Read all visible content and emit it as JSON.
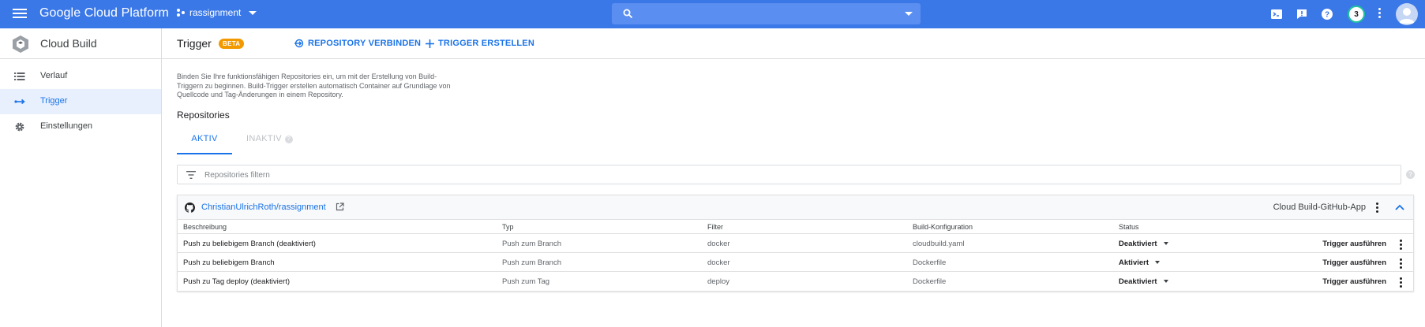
{
  "topbar": {
    "brand": "Google Cloud Platform",
    "project": "rassignment",
    "search_placeholder": "",
    "notification_count": "3",
    "accent_color": "#3b78e7"
  },
  "sidebar": {
    "title": "Cloud Build",
    "items": [
      {
        "label": "Verlauf",
        "icon": "list-icon",
        "active": false
      },
      {
        "label": "Trigger",
        "icon": "trigger-arrows-icon",
        "active": true
      },
      {
        "label": "Einstellungen",
        "icon": "gear-icon",
        "active": false
      }
    ]
  },
  "header": {
    "title": "Trigger",
    "badge": "BETA",
    "connect_repo": "REPOSITORY VERBINDEN",
    "create_trigger": "TRIGGER ERSTELLEN"
  },
  "main": {
    "intro": "Binden Sie Ihre funktionsfähigen Repositories ein, um mit der Erstellung von Build-Triggern zu beginnen. Build-Trigger erstellen automatisch Container auf Grundlage von Quellcode und Tag-Änderungen in einem Repository.",
    "section_title": "Repositories",
    "tabs": [
      {
        "label": "AKTIV",
        "active": true
      },
      {
        "label": "INAKTIV",
        "active": false
      }
    ],
    "filter_placeholder": "Repositories filtern"
  },
  "repo": {
    "name": "ChristianUlrichRoth/rassignment",
    "app": "Cloud Build-GitHub-App",
    "columns": [
      "Beschreibung",
      "Typ",
      "Filter",
      "Build-Konfiguration",
      "Status"
    ],
    "rows": [
      {
        "description": "Push zu beliebigem Branch (deaktiviert)",
        "type": "Push zum Branch",
        "filter": "docker",
        "config": "cloudbuild.yaml",
        "status": "Deaktiviert",
        "action": "Trigger ausführen"
      },
      {
        "description": "Push zu beliebigem Branch",
        "type": "Push zum Branch",
        "filter": "docker",
        "config": "Dockerfile",
        "status": "Aktiviert",
        "action": "Trigger ausführen"
      },
      {
        "description": "Push zu Tag deploy (deaktiviert)",
        "type": "Push zum Tag",
        "filter": "deploy",
        "config": "Dockerfile",
        "status": "Deaktiviert",
        "action": "Trigger ausführen"
      }
    ]
  }
}
